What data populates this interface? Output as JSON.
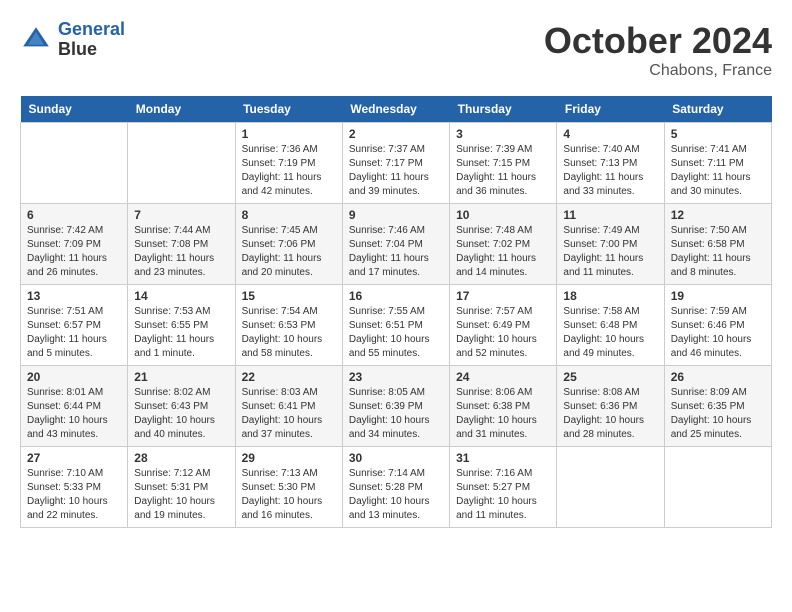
{
  "header": {
    "logo_line1": "General",
    "logo_line2": "Blue",
    "month": "October 2024",
    "location": "Chabons, France"
  },
  "weekdays": [
    "Sunday",
    "Monday",
    "Tuesday",
    "Wednesday",
    "Thursday",
    "Friday",
    "Saturday"
  ],
  "weeks": [
    [
      {
        "day": "",
        "info": ""
      },
      {
        "day": "",
        "info": ""
      },
      {
        "day": "1",
        "info": "Sunrise: 7:36 AM\nSunset: 7:19 PM\nDaylight: 11 hours and 42 minutes."
      },
      {
        "day": "2",
        "info": "Sunrise: 7:37 AM\nSunset: 7:17 PM\nDaylight: 11 hours and 39 minutes."
      },
      {
        "day": "3",
        "info": "Sunrise: 7:39 AM\nSunset: 7:15 PM\nDaylight: 11 hours and 36 minutes."
      },
      {
        "day": "4",
        "info": "Sunrise: 7:40 AM\nSunset: 7:13 PM\nDaylight: 11 hours and 33 minutes."
      },
      {
        "day": "5",
        "info": "Sunrise: 7:41 AM\nSunset: 7:11 PM\nDaylight: 11 hours and 30 minutes."
      }
    ],
    [
      {
        "day": "6",
        "info": "Sunrise: 7:42 AM\nSunset: 7:09 PM\nDaylight: 11 hours and 26 minutes."
      },
      {
        "day": "7",
        "info": "Sunrise: 7:44 AM\nSunset: 7:08 PM\nDaylight: 11 hours and 23 minutes."
      },
      {
        "day": "8",
        "info": "Sunrise: 7:45 AM\nSunset: 7:06 PM\nDaylight: 11 hours and 20 minutes."
      },
      {
        "day": "9",
        "info": "Sunrise: 7:46 AM\nSunset: 7:04 PM\nDaylight: 11 hours and 17 minutes."
      },
      {
        "day": "10",
        "info": "Sunrise: 7:48 AM\nSunset: 7:02 PM\nDaylight: 11 hours and 14 minutes."
      },
      {
        "day": "11",
        "info": "Sunrise: 7:49 AM\nSunset: 7:00 PM\nDaylight: 11 hours and 11 minutes."
      },
      {
        "day": "12",
        "info": "Sunrise: 7:50 AM\nSunset: 6:58 PM\nDaylight: 11 hours and 8 minutes."
      }
    ],
    [
      {
        "day": "13",
        "info": "Sunrise: 7:51 AM\nSunset: 6:57 PM\nDaylight: 11 hours and 5 minutes."
      },
      {
        "day": "14",
        "info": "Sunrise: 7:53 AM\nSunset: 6:55 PM\nDaylight: 11 hours and 1 minute."
      },
      {
        "day": "15",
        "info": "Sunrise: 7:54 AM\nSunset: 6:53 PM\nDaylight: 10 hours and 58 minutes."
      },
      {
        "day": "16",
        "info": "Sunrise: 7:55 AM\nSunset: 6:51 PM\nDaylight: 10 hours and 55 minutes."
      },
      {
        "day": "17",
        "info": "Sunrise: 7:57 AM\nSunset: 6:49 PM\nDaylight: 10 hours and 52 minutes."
      },
      {
        "day": "18",
        "info": "Sunrise: 7:58 AM\nSunset: 6:48 PM\nDaylight: 10 hours and 49 minutes."
      },
      {
        "day": "19",
        "info": "Sunrise: 7:59 AM\nSunset: 6:46 PM\nDaylight: 10 hours and 46 minutes."
      }
    ],
    [
      {
        "day": "20",
        "info": "Sunrise: 8:01 AM\nSunset: 6:44 PM\nDaylight: 10 hours and 43 minutes."
      },
      {
        "day": "21",
        "info": "Sunrise: 8:02 AM\nSunset: 6:43 PM\nDaylight: 10 hours and 40 minutes."
      },
      {
        "day": "22",
        "info": "Sunrise: 8:03 AM\nSunset: 6:41 PM\nDaylight: 10 hours and 37 minutes."
      },
      {
        "day": "23",
        "info": "Sunrise: 8:05 AM\nSunset: 6:39 PM\nDaylight: 10 hours and 34 minutes."
      },
      {
        "day": "24",
        "info": "Sunrise: 8:06 AM\nSunset: 6:38 PM\nDaylight: 10 hours and 31 minutes."
      },
      {
        "day": "25",
        "info": "Sunrise: 8:08 AM\nSunset: 6:36 PM\nDaylight: 10 hours and 28 minutes."
      },
      {
        "day": "26",
        "info": "Sunrise: 8:09 AM\nSunset: 6:35 PM\nDaylight: 10 hours and 25 minutes."
      }
    ],
    [
      {
        "day": "27",
        "info": "Sunrise: 7:10 AM\nSunset: 5:33 PM\nDaylight: 10 hours and 22 minutes."
      },
      {
        "day": "28",
        "info": "Sunrise: 7:12 AM\nSunset: 5:31 PM\nDaylight: 10 hours and 19 minutes."
      },
      {
        "day": "29",
        "info": "Sunrise: 7:13 AM\nSunset: 5:30 PM\nDaylight: 10 hours and 16 minutes."
      },
      {
        "day": "30",
        "info": "Sunrise: 7:14 AM\nSunset: 5:28 PM\nDaylight: 10 hours and 13 minutes."
      },
      {
        "day": "31",
        "info": "Sunrise: 7:16 AM\nSunset: 5:27 PM\nDaylight: 10 hours and 11 minutes."
      },
      {
        "day": "",
        "info": ""
      },
      {
        "day": "",
        "info": ""
      }
    ]
  ]
}
